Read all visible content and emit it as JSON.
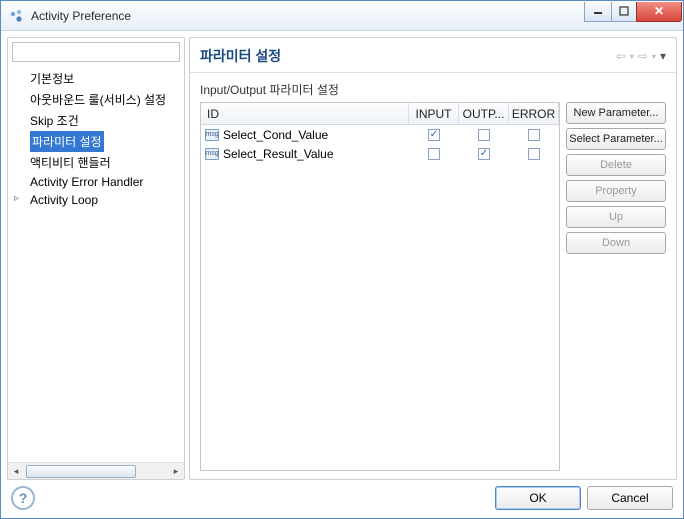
{
  "window": {
    "title": "Activity Preference"
  },
  "tree": {
    "items": [
      {
        "label": "기본정보"
      },
      {
        "label": "아웃바운드 룰(서비스) 설정"
      },
      {
        "label": "Skip 조건"
      },
      {
        "label": "파라미터 설정",
        "selected": true
      },
      {
        "label": "액티비티 핸들러"
      },
      {
        "label": "Activity Error Handler"
      },
      {
        "label": "Activity Loop",
        "expandable": true
      }
    ]
  },
  "page": {
    "title": "파라미터 설정",
    "group_label": "Input/Output 파라미터 설정",
    "columns": {
      "id": "ID",
      "input": "INPUT",
      "output": "OUTP...",
      "error": "ERROR"
    },
    "rows": [
      {
        "id": "Select_Cond_Value",
        "input": true,
        "output": false,
        "error": false
      },
      {
        "id": "Select_Result_Value",
        "input": false,
        "output": true,
        "error": false
      }
    ],
    "buttons": {
      "new": "New Parameter...",
      "select": "Select Parameter...",
      "delete": "Delete",
      "property": "Property",
      "up": "Up",
      "down": "Down"
    }
  },
  "footer": {
    "ok": "OK",
    "cancel": "Cancel"
  },
  "icons": {
    "msg": "msg"
  }
}
